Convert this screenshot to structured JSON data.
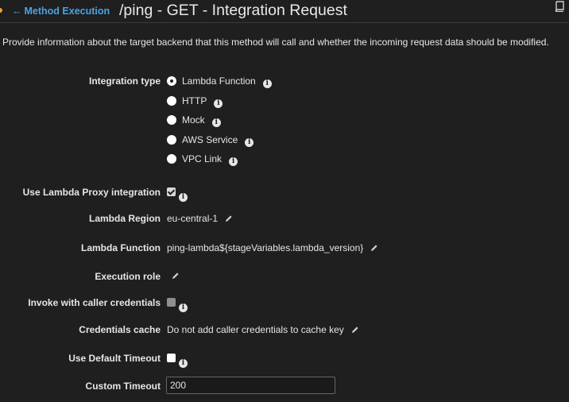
{
  "header": {
    "back_link": "Method Execution",
    "back_arrow": "←",
    "title": "/ping - GET - Integration Request"
  },
  "description": "Provide information about the target backend that this method will call and whether the incoming request data should be modified.",
  "integration_type": {
    "label": "Integration type",
    "options": [
      {
        "label": "Lambda Function",
        "selected": true
      },
      {
        "label": "HTTP",
        "selected": false
      },
      {
        "label": "Mock",
        "selected": false
      },
      {
        "label": "AWS Service",
        "selected": false
      },
      {
        "label": "VPC Link",
        "selected": false
      }
    ]
  },
  "proxy": {
    "label": "Use Lambda Proxy integration",
    "checked": true
  },
  "region": {
    "label": "Lambda Region",
    "value": "eu-central-1"
  },
  "function": {
    "label": "Lambda Function",
    "value": "ping-lambda${stageVariables.lambda_version}"
  },
  "execution_role": {
    "label": "Execution role",
    "value": ""
  },
  "invoke_caller": {
    "label": "Invoke with caller credentials",
    "checked": false,
    "disabled": true
  },
  "credentials_cache": {
    "label": "Credentials cache",
    "value": "Do not add caller credentials to cache key"
  },
  "default_timeout": {
    "label": "Use Default Timeout",
    "checked": false
  },
  "custom_timeout": {
    "label": "Custom Timeout",
    "value": "200"
  },
  "info_glyph": "i",
  "colors": {
    "background": "#1f1f1f",
    "link": "#4aa3e0",
    "text": "#e6e6e6"
  }
}
